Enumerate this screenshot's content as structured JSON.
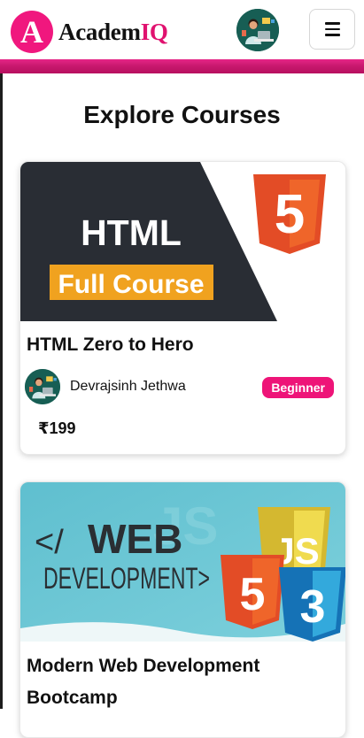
{
  "header": {
    "logo_letter": "A",
    "logo_text_main": "Academ",
    "logo_text_accent": "IQ",
    "brand_color": "#e0126f",
    "profile_avatar_icon": "avatar-icon",
    "menu_icon": "hamburger-icon"
  },
  "page": {
    "title": "Explore Courses"
  },
  "courses": [
    {
      "title": "HTML Zero to Hero",
      "thumb_heading": "HTML",
      "thumb_subheading": "Full Course",
      "thumb_badge": "5",
      "instructor": "Devrajsinh Jethwa",
      "level": "Beginner",
      "price": "₹199"
    },
    {
      "title": "Modern Web Development Bootcamp",
      "thumb_prefix": "</",
      "thumb_heading": "WEB",
      "thumb_subheading": "DEVELOPMENT>",
      "thumb_badge_html": "5",
      "thumb_badge_js": "JS",
      "thumb_badge_css": "3"
    }
  ]
}
